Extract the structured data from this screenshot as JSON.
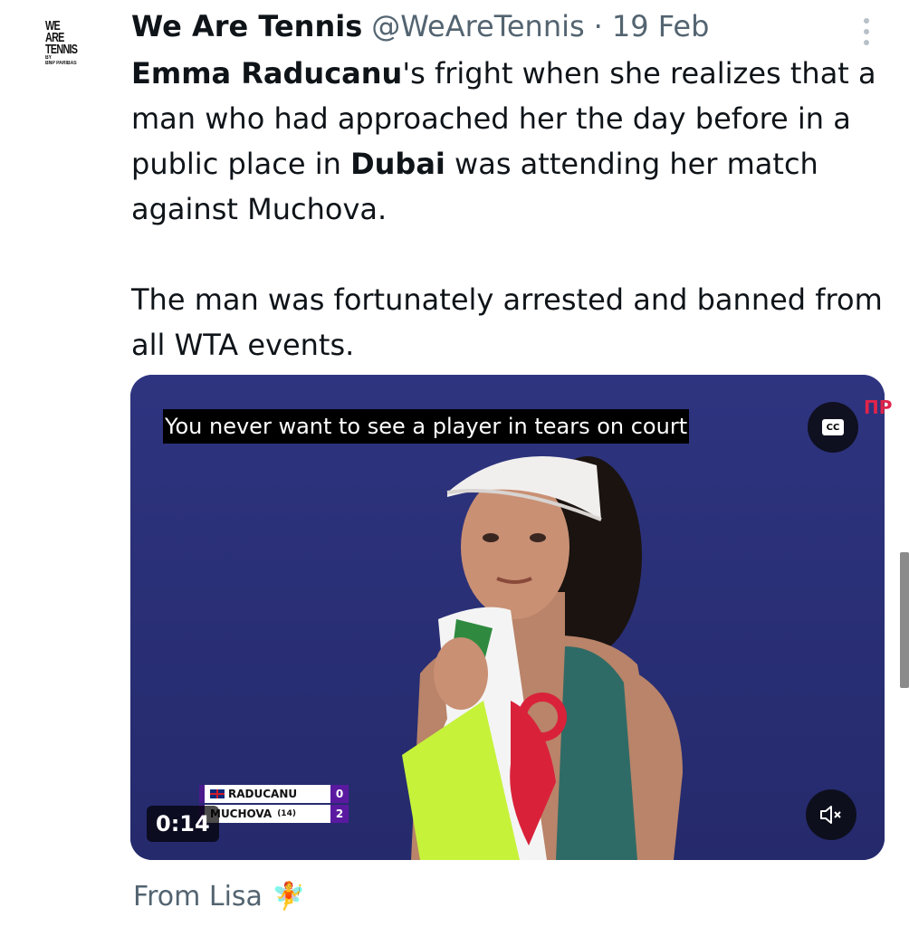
{
  "account": {
    "display_name": "We Are Tennis",
    "handle": "@WeAreTennis",
    "separator": "·",
    "date": "19 Feb",
    "avatar_lines": [
      "WE",
      "ARE",
      "TENNIS",
      "BY",
      "BNP PARIBAS"
    ]
  },
  "tweet": {
    "p1_bold1": "Emma Raducanu",
    "p1_text1": "'s fright when she realizes that a man who had approached her the day before in a public place in ",
    "p1_bold2": "Dubai",
    "p1_text2": " was attending her match against Muchova.",
    "p2": "The man was fortunately arrested and banned from all WTA events."
  },
  "video": {
    "caption": "You never want to see a player in tears on court",
    "cc_label": "CC",
    "channel_mark": "ΠP",
    "timestamp": "0:14",
    "scoreboard": [
      {
        "name": "RADUCANU",
        "seed": "",
        "score": "0"
      },
      {
        "name": "MUCHOVA",
        "seed": "(14)",
        "score": "2"
      }
    ]
  },
  "footer": {
    "from_label": "From Lisa",
    "emoji": "🧚"
  },
  "icons": {
    "more": "more-vertical-icon",
    "cc": "closed-captions-icon",
    "mute": "speaker-muted-icon"
  },
  "colors": {
    "text": "#0f1419",
    "muted": "#536471",
    "court_blue": "#2a2f7a",
    "scoreboard_purple": "#5a1aa0"
  }
}
